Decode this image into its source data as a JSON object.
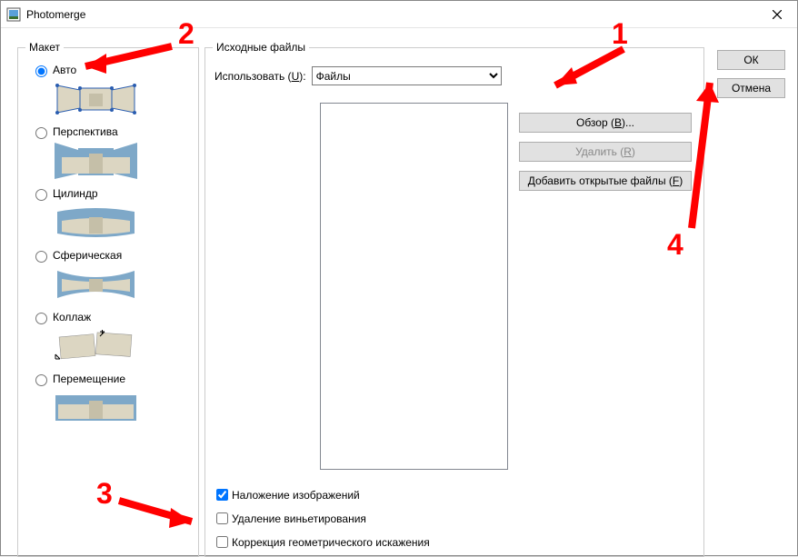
{
  "window": {
    "title": "Photomerge"
  },
  "layout": {
    "legend": "Макет",
    "options": [
      {
        "label": "Авто",
        "checked": true
      },
      {
        "label": "Перспектива",
        "checked": false
      },
      {
        "label": "Цилиндр",
        "checked": false
      },
      {
        "label": "Сферическая",
        "checked": false
      },
      {
        "label": "Коллаж",
        "checked": false
      },
      {
        "label": "Перемещение",
        "checked": false
      }
    ]
  },
  "source": {
    "legend": "Исходные файлы",
    "use_label_pre": "Использовать (",
    "use_label_u": "U",
    "use_label_post": "):",
    "dropdown_value": "Файлы",
    "browse_pre": "Обзор (",
    "browse_u": "B",
    "browse_post": ")...",
    "remove_pre": "Удалить (",
    "remove_u": "R",
    "remove_post": ")",
    "addopen_pre": "Добавить открытые файлы (",
    "addopen_u": "F",
    "addopen_post": ")",
    "chk_blend": "Наложение изображений",
    "chk_vignette": "Удаление виньетирования",
    "chk_geo": "Коррекция геометрического искажения"
  },
  "buttons": {
    "ok": "ОК",
    "cancel": "Отмена"
  },
  "annotations": {
    "n1": "1",
    "n2": "2",
    "n3": "3",
    "n4": "4"
  }
}
